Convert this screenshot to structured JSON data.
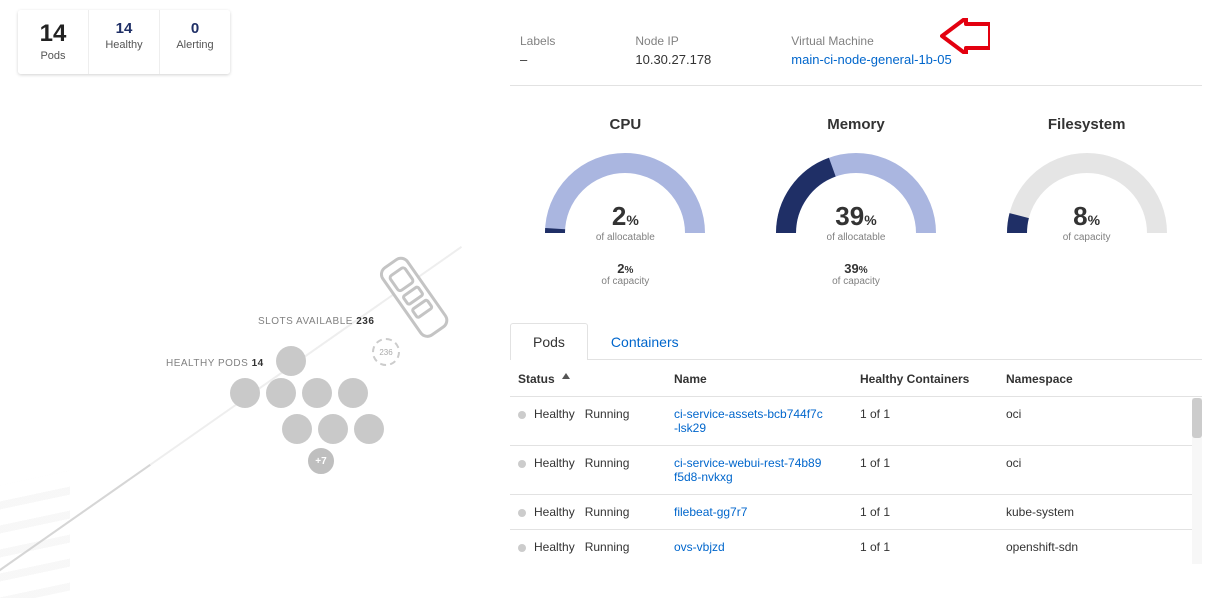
{
  "summary": {
    "pods_total_value": "14",
    "pods_total_label": "Pods",
    "healthy_value": "14",
    "healthy_label": "Healthy",
    "alerting_value": "0",
    "alerting_label": "Alerting"
  },
  "info": {
    "labels_label": "Labels",
    "labels_value": "–",
    "nodeip_label": "Node IP",
    "nodeip_value": "10.30.27.178",
    "vm_label": "Virtual Machine",
    "vm_value": "main-ci-node-general-1b-05"
  },
  "chart_data": [
    {
      "type": "pie",
      "title": "CPU",
      "value_pct": 2,
      "caption_primary": "of allocatable",
      "secondary_pct": 2,
      "caption_secondary": "of capacity",
      "colors": {
        "fill": "#1f2f66",
        "track": "#aab6e0"
      }
    },
    {
      "type": "pie",
      "title": "Memory",
      "value_pct": 39,
      "caption_primary": "of allocatable",
      "secondary_pct": 39,
      "caption_secondary": "of capacity",
      "colors": {
        "fill": "#1f2f66",
        "track": "#aab6e0"
      }
    },
    {
      "type": "pie",
      "title": "Filesystem",
      "value_pct": 8,
      "caption_primary": "of capacity",
      "secondary_pct": null,
      "caption_secondary": "",
      "colors": {
        "fill": "#1f2f66",
        "track": "#e5e5e5"
      }
    }
  ],
  "tabs": {
    "pods": "Pods",
    "containers": "Containers"
  },
  "table": {
    "headers": {
      "status": "Status",
      "name": "Name",
      "healthy": "Healthy Containers",
      "namespace": "Namespace"
    },
    "running_state": "Running",
    "rows": [
      {
        "health": "Healthy",
        "name": "ci-service-assets-bcb744f7c-lsk29",
        "hc": "1 of 1",
        "ns": "oci"
      },
      {
        "health": "Healthy",
        "name": "ci-service-webui-rest-74b89f5d8-nvkxg",
        "hc": "1 of 1",
        "ns": "oci"
      },
      {
        "health": "Healthy",
        "name": "filebeat-gg7r7",
        "hc": "1 of 1",
        "ns": "kube-system"
      },
      {
        "health": "Healthy",
        "name": "ovs-vbjzd",
        "hc": "1 of 1",
        "ns": "openshift-sdn"
      }
    ]
  },
  "slots": {
    "available_label": "SLOTS AVAILABLE",
    "available_value": "236",
    "healthy_label": "HEALTHY PODS",
    "healthy_value": "14",
    "pin_label": "236",
    "plus_label": "+7"
  }
}
